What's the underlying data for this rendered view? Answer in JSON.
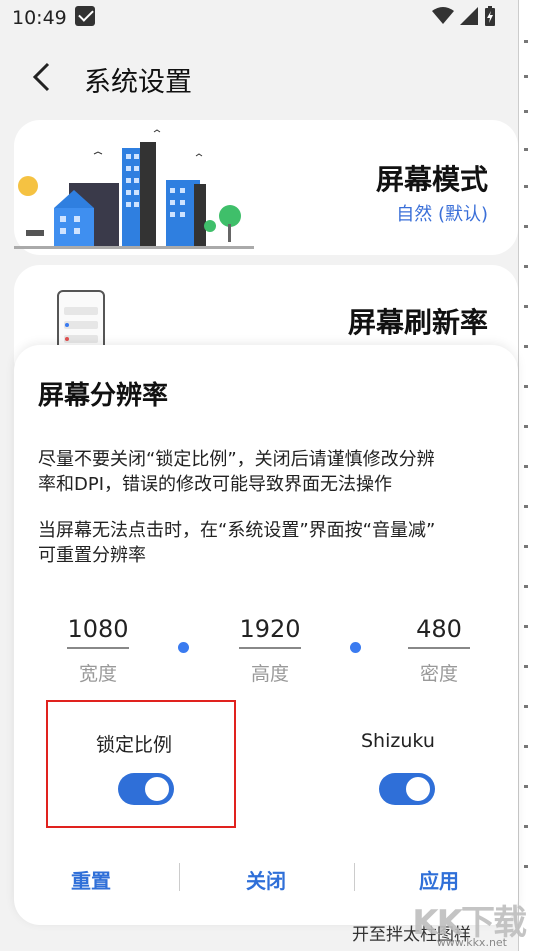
{
  "status_bar": {
    "time": "10:49"
  },
  "header": {
    "title": "系统设置"
  },
  "cards": [
    {
      "name": "屏幕模式",
      "value": "自然 (默认)"
    },
    {
      "name": "屏幕刷新率",
      "value": ""
    }
  ],
  "dialog": {
    "title": "屏幕分辨率",
    "text1_line1": "尽量不要关闭“锁定比例”，关闭后请谨慎修改分辨",
    "text1_line2": "率和DPI，错误的修改可能导致界面无法操作",
    "text2_line1": "当屏幕无法点击时，在“系统设置”界面按“音量减”",
    "text2_line2": "可重置分辨率",
    "fields": [
      {
        "value": "1080",
        "label": "宽度"
      },
      {
        "value": "1920",
        "label": "高度"
      },
      {
        "value": "480",
        "label": "密度"
      }
    ],
    "lock_ratio": {
      "label": "锁定比例",
      "on": true
    },
    "shizuku": {
      "label": "Shizuku",
      "on": true
    },
    "buttons": {
      "reset": "重置",
      "close": "关闭",
      "apply": "应用"
    }
  },
  "background_text": "开至拌太柱图样",
  "watermark": "KK下载",
  "watermark_url": "www.kkx.net",
  "colors": {
    "accent": "#2f6fd8",
    "highlight_box": "#e0221e"
  }
}
